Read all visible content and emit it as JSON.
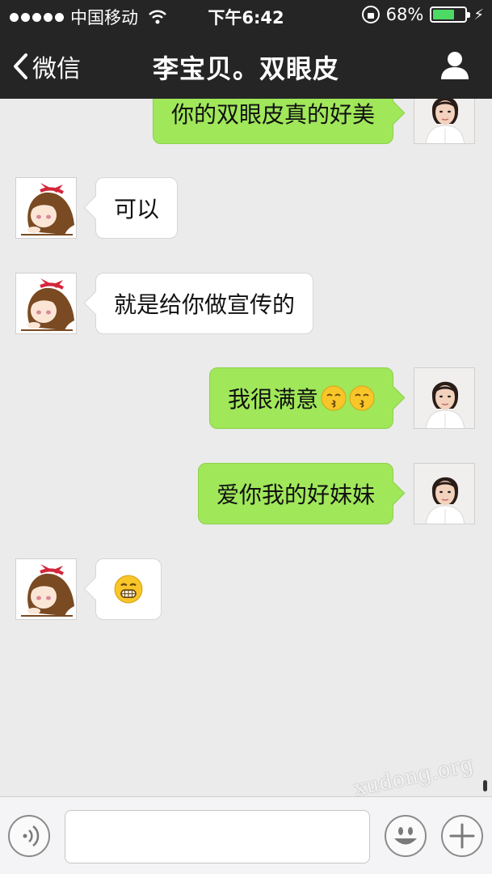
{
  "status_bar": {
    "carrier": "中国移动",
    "time": "下午6:42",
    "battery_percent": "68%",
    "battery_level": 0.68,
    "signal_dots": 5
  },
  "nav": {
    "back_label": "微信",
    "title": "李宝贝。双眼皮"
  },
  "messages": [
    {
      "side": "right",
      "text": "你的双眼皮真的好美",
      "emoji": []
    },
    {
      "side": "left",
      "text": "可以",
      "emoji": []
    },
    {
      "side": "left",
      "text": "就是给你做宣传的",
      "emoji": []
    },
    {
      "side": "right",
      "text": "我很满意",
      "emoji": [
        "kissing-face-icon",
        "kissing-face-icon"
      ]
    },
    {
      "side": "right",
      "text": "爱你我的好妹妹",
      "emoji": []
    },
    {
      "side": "left",
      "text": "",
      "emoji": [
        "grinning-face-icon"
      ]
    }
  ],
  "input": {
    "value": ""
  },
  "watermark": "xudong.org",
  "colors": {
    "nav_bg": "#252526",
    "chat_bg": "#ebebeb",
    "sent_bubble": "#a0e75a",
    "received_bubble": "#ffffff",
    "battery_green": "#4cd964"
  },
  "icons": {
    "back": "chevron-left-icon",
    "contact": "person-icon",
    "voice": "voice-icon",
    "emoji": "smiley-icon",
    "more": "plus-icon"
  }
}
